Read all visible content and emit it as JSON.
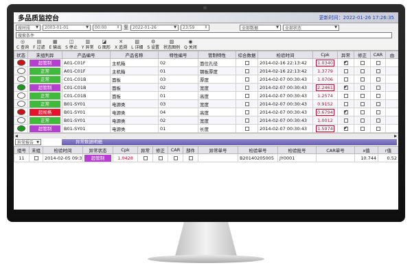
{
  "app": {
    "title": "多品质监控台",
    "clock": "更新时间：2022-01-26 17:26:35"
  },
  "filter": {
    "time_mode": "按时段",
    "start_date": "2003-01-01",
    "start_time": "00:00",
    "to_label": "至",
    "end_date": "2022-01-26",
    "end_time": "23:59",
    "data_scope": "全部数据",
    "status_scope": "全部状态",
    "search_placeholder": "搜索条件"
  },
  "toolbar": [
    {
      "label": "查询",
      "key": "C",
      "icon": "◎"
    },
    {
      "label": "过滤",
      "key": "F",
      "icon": "▤"
    },
    {
      "label": "输出",
      "key": "E",
      "icon": "▦"
    },
    {
      "label": "停止",
      "key": "S",
      "icon": "◫"
    },
    {
      "label": "异常",
      "key": "Y",
      "icon": "▥"
    },
    {
      "label": "图形",
      "key": "G",
      "icon": "◪"
    },
    {
      "label": "追溯",
      "key": "X",
      "icon": "✕"
    },
    {
      "label": "详细",
      "key": "L",
      "icon": "▧"
    },
    {
      "label": "设置",
      "key": "S",
      "icon": "⚙"
    },
    {
      "label": "状态图例",
      "key": "",
      "icon": "▨"
    },
    {
      "label": "关闭",
      "key": "Q",
      "icon": "◉"
    }
  ],
  "colors": {
    "green": "#3fba3a",
    "purple": "#b63fd2",
    "red": "#e8122a",
    "dot_green": "#1a9a1a",
    "dot_red": "#d01010"
  },
  "grid": {
    "headers": [
      "状态",
      "末组判异",
      "产品编号",
      "产品名称",
      "特性编号",
      "管制特性",
      "综合数据",
      "检验时间",
      "Cpk",
      "异常",
      "修正",
      "CAR",
      "由"
    ],
    "rows": [
      {
        "dot": "red",
        "status": "超管制",
        "status_color": "purple",
        "prod_no": "A01-C01F",
        "prod_name": "主机箱",
        "feat_no": "02",
        "feat": "面位孔径",
        "combo": false,
        "time": "2014-02-16 22:13:42",
        "cpk": "1.0340",
        "cpk_boxed": true,
        "abn": true,
        "fix": false,
        "car": false
      },
      {
        "dot": "white",
        "status": "正常",
        "status_color": "green",
        "prod_no": "A01-C01F",
        "prod_name": "主机箱",
        "feat_no": "01",
        "feat": "钢板厚度",
        "combo": false,
        "time": "2014-02-16 22:13:42",
        "cpk": "1.3779",
        "cpk_boxed": false,
        "abn": false,
        "fix": false,
        "car": false
      },
      {
        "dot": "white",
        "status": "正常",
        "status_color": "green",
        "prod_no": "C01-C01B",
        "prod_name": "面板",
        "feat_no": "03",
        "feat": "厚度",
        "combo": false,
        "time": "2014-02-07 00:30:43",
        "cpk": "1.0706",
        "cpk_boxed": false,
        "abn": false,
        "fix": false,
        "car": false
      },
      {
        "dot": "green",
        "status": "超管制",
        "status_color": "purple",
        "prod_no": "C01-C01B",
        "prod_name": "面板",
        "feat_no": "02",
        "feat": "宽度",
        "combo": false,
        "time": "2014-02-07 00:30:43",
        "cpk": "2.2461",
        "cpk_boxed": true,
        "abn": true,
        "fix": false,
        "car": false
      },
      {
        "dot": "white",
        "status": "正常",
        "status_color": "green",
        "prod_no": "C01-C01B",
        "prod_name": "面板",
        "feat_no": "01",
        "feat": "高度",
        "combo": false,
        "time": "2014-02-07 00:30:43",
        "cpk": "1.2574",
        "cpk_boxed": false,
        "abn": false,
        "fix": false,
        "car": false
      },
      {
        "dot": "white",
        "status": "正常",
        "status_color": "green",
        "prod_no": "B01-SY01",
        "prod_name": "电源类",
        "feat_no": "03",
        "feat": "宽度",
        "combo": false,
        "time": "2014-02-07 00:30:43",
        "cpk": "0.9152",
        "cpk_boxed": false,
        "abn": false,
        "fix": false,
        "car": false
      },
      {
        "dot": "red",
        "status": "超规格",
        "status_color": "red",
        "prod_no": "B01-SY01",
        "prod_name": "电源类",
        "feat_no": "04",
        "feat": "高度",
        "combo": false,
        "time": "2014-02-07 00:30:43",
        "cpk": "0.6794",
        "cpk_boxed": true,
        "abn": true,
        "fix": false,
        "car": false
      },
      {
        "dot": "white",
        "status": "正常",
        "status_color": "green",
        "prod_no": "B01-SY01",
        "prod_name": "电源类",
        "feat_no": "02",
        "feat": "宽度",
        "combo": false,
        "time": "2014-02-07 00:30:43",
        "cpk": "1.0012",
        "cpk_boxed": false,
        "abn": false,
        "fix": false,
        "car": false
      },
      {
        "dot": "green",
        "status": "超管制",
        "status_color": "purple",
        "prod_no": "B01-SY01",
        "prod_name": "电源类",
        "feat_no": "01",
        "feat": "长度",
        "combo": false,
        "time": "2014-02-07 00:30:43",
        "cpk": "1.5974",
        "cpk_boxed": true,
        "abn": true,
        "fix": false,
        "car": false
      }
    ]
  },
  "subpanel": {
    "selector": "异常报告",
    "title": "异常数据明细",
    "headers": [
      "组号",
      "末组",
      "检验时间",
      "异常状态",
      "Cpk",
      "异常",
      "修正",
      "CAR",
      "部件",
      "异常单号",
      "检验单号",
      "检验批号",
      "CAR单号",
      "x值",
      "r值"
    ],
    "row": {
      "group": "11",
      "last": false,
      "time": "2014-02-05 09:32:41",
      "status": "超管制",
      "cpk": "1.0428",
      "abn": false,
      "fix": false,
      "car": false,
      "part": false,
      "abn_no": "",
      "insp_no": "B20140205005",
      "lot_no": "JY0001",
      "car_no": "",
      "x": "10.744",
      "r": "0.52"
    }
  }
}
